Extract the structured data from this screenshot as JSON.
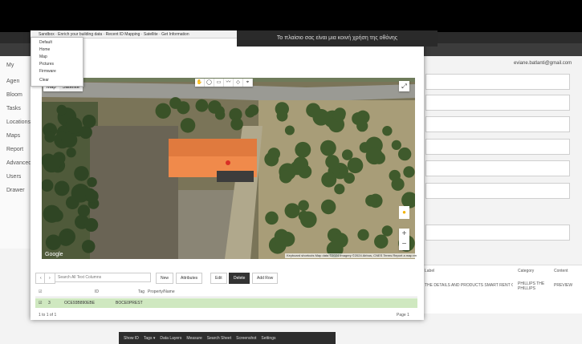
{
  "background": {
    "sidebar_items": [
      "My",
      "Agen",
      "Bloom",
      "Tasks",
      "Locations",
      "Maps",
      "Report",
      "Advanced",
      "Users",
      "Drawer"
    ],
    "account": "eviane.batlanti@gmail.com",
    "table_headers": [
      "Label",
      "Category",
      "Content"
    ],
    "table_row": [
      "THE DETAILS AND PRODUCTS SMART RENT COMPONENT",
      "PHILLIPS THE PHILLIPS",
      "PREVIEW"
    ]
  },
  "notice": {
    "text": "Το πλαίσιο σας είναι μια κοινή χρήση της οθόνης"
  },
  "popup": {
    "title": "Sandbox · Enrich your building data · Recent ID Mapping · Satellite · Get Information"
  },
  "menu": {
    "items": [
      "Default",
      "Home",
      "Map",
      "Pictures",
      "Firmware",
      "Clear"
    ]
  },
  "map": {
    "type_buttons": [
      "Map",
      "Satellite"
    ],
    "draw_tools": [
      "✋",
      "◯",
      "▭",
      "〰",
      "◇",
      "⌖"
    ],
    "fullscreen_icon": "⤢",
    "zoom_in": "+",
    "zoom_out": "−",
    "footer": "Keyboard shortcuts  Map data ©2024  Imagery ©2024 Airbus, CNES  Terms  Report a map error"
  },
  "table": {
    "nav_buttons": [
      "‹",
      "›"
    ],
    "search_placeholder": "Search All Text Columns",
    "buttons": [
      "New",
      "Attributes",
      "Edit",
      "Delete",
      "Add Row"
    ],
    "columns": [
      "ID",
      "Tag",
      "Property/Name"
    ],
    "row": [
      "3",
      "OCE93B890EBE",
      "BOCE0PREST"
    ],
    "footer_left": "1 to 1 of 1",
    "footer_right": "Page 1"
  },
  "taskbar": {
    "items": [
      "Show ID",
      "Tags ▾",
      "Data Layers",
      "Measure",
      "Search Sheet",
      "Screenshot",
      "Settings"
    ]
  },
  "colors": {
    "roof": "#f08a4b",
    "row_highlight": "#cfe8c0",
    "taskbar": "#2d2d2d"
  }
}
